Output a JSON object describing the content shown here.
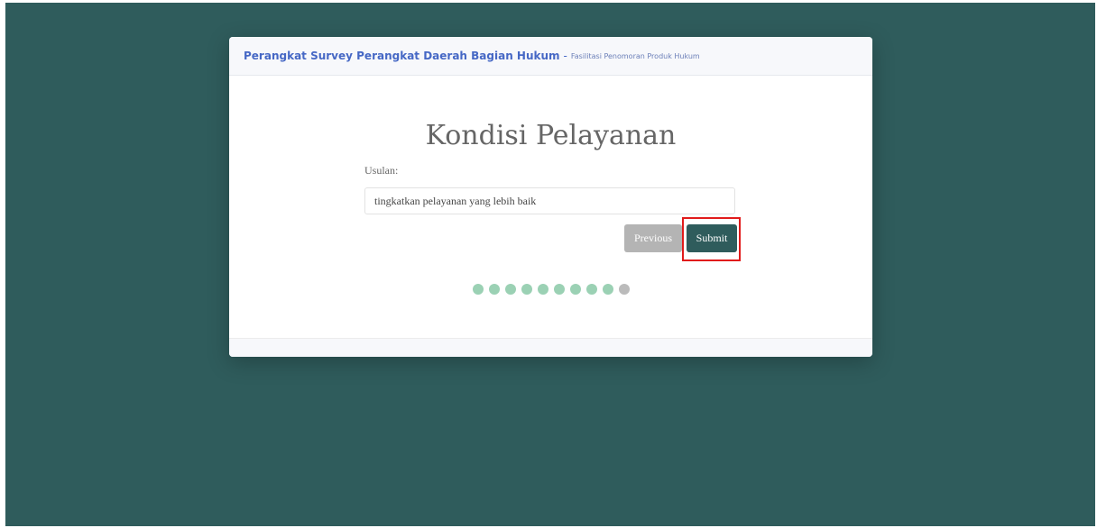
{
  "header": {
    "title": "Perangkat Survey Perangkat Daerah Bagian Hukum",
    "separator": "-",
    "subtitle": "Fasilitasi Penomoran Produk Hukum"
  },
  "section": {
    "heading": "Kondisi Pelayanan",
    "field_label": "Usulan:",
    "field_value": "tingkatkan pelayanan yang lebih baik"
  },
  "buttons": {
    "previous_label": "Previous",
    "submit_label": "Submit"
  },
  "progress": {
    "total_steps": 10,
    "completed_steps": 9,
    "active_color": "#9bd1b4",
    "inactive_color": "#bbbbbb"
  },
  "colors": {
    "background": "#2f5c5c",
    "accent_blue": "#4668c5",
    "submit_button": "#2f5c5c",
    "previous_button": "#b4b4b4",
    "highlight": "#e11b1b"
  }
}
